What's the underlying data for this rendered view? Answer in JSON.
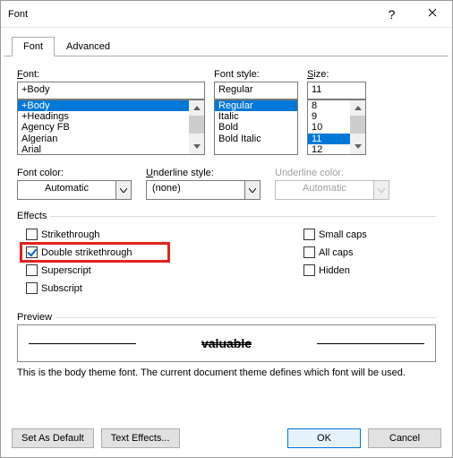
{
  "title": "Font",
  "tabs": {
    "font": "Font",
    "advanced": "Advanced"
  },
  "labels": {
    "font": "Font:",
    "fontStyle": "Font style:",
    "size": "Size:",
    "fontColor": "Font color:",
    "underlineStyle": "Underline style:",
    "underlineColor": "Underline color:",
    "effects": "Effects",
    "preview": "Preview"
  },
  "fontInput": "+Body",
  "fontList": [
    "+Body",
    "+Headings",
    "Agency FB",
    "Algerian",
    "Arial"
  ],
  "fontSelectedIndex": 0,
  "styleInput": "Regular",
  "styleList": [
    "Regular",
    "Italic",
    "Bold",
    "Bold Italic"
  ],
  "styleSelectedIndex": 0,
  "sizeInput": "11",
  "sizeList": [
    "8",
    "9",
    "10",
    "11",
    "12"
  ],
  "sizeSelectedIndex": 3,
  "fontColor": {
    "value": "Automatic"
  },
  "underlineStyle": {
    "value": "(none)"
  },
  "underlineColor": {
    "value": "Automatic"
  },
  "effects": {
    "strikethrough": {
      "label": "Strikethrough",
      "checked": false
    },
    "doubleStrikethrough": {
      "label": "Double strikethrough",
      "checked": true
    },
    "superscript": {
      "label": "Superscript",
      "checked": false
    },
    "subscript": {
      "label": "Subscript",
      "checked": false
    },
    "smallCaps": {
      "label": "Small caps",
      "checked": false
    },
    "allCaps": {
      "label": "All caps",
      "checked": false
    },
    "hidden": {
      "label": "Hidden",
      "checked": false
    }
  },
  "previewText": "valuable",
  "hintText": "This is the body theme font. The current document theme defines which font will be used.",
  "buttons": {
    "setDefault": "Set As Default",
    "textEffects": "Text Effects...",
    "ok": "OK",
    "cancel": "Cancel"
  }
}
